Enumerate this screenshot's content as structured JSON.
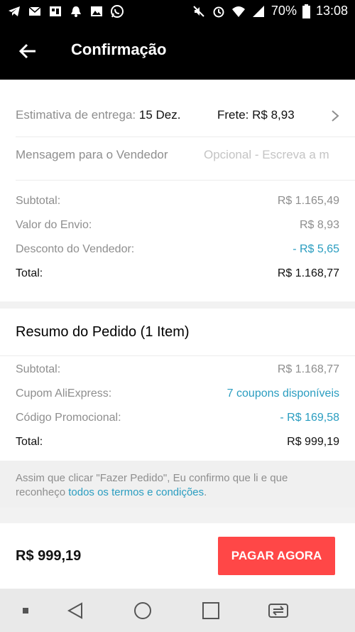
{
  "status_bar": {
    "battery": "70%",
    "time": "13:08"
  },
  "header": {
    "title": "Confirmação"
  },
  "delivery": {
    "estimate_label": "Estimativa de entrega:",
    "estimate_value": "15 Dez.",
    "shipping_label": "Frete: R$ 8,93"
  },
  "message": {
    "label": "Mensagem para o Vendedor",
    "placeholder": "Opcional - Escreva a m"
  },
  "store_summary": {
    "subtotal_label": "Subtotal:",
    "subtotal_value": "R$ 1.165,49",
    "shipping_label": "Valor do Envio:",
    "shipping_value": "R$ 8,93",
    "discount_label": "Desconto do Vendedor:",
    "discount_value": "- R$ 5,65",
    "total_label": "Total:",
    "total_value": "R$ 1.168,77"
  },
  "order_summary": {
    "heading": "Resumo do Pedido (1 Item)",
    "subtotal_label": "Subtotal:",
    "subtotal_value": "R$ 1.168,77",
    "coupon_label": "Cupom AliExpress:",
    "coupon_value": "7 coupons disponíveis",
    "promo_label": "Código Promocional:",
    "promo_value": "- R$ 169,58",
    "total_label": "Total:",
    "total_value": "R$ 999,19"
  },
  "terms": {
    "text": "Assim que clicar \"Fazer Pedido\", Eu confirmo que li e que reconheço ",
    "link": "todos os termos e condições",
    "end": "."
  },
  "pay_bar": {
    "total": "R$ 999,19",
    "button_label": "PAGAR AGORA"
  },
  "colors": {
    "accent": "#ff4747",
    "link": "#2a9dc0"
  }
}
